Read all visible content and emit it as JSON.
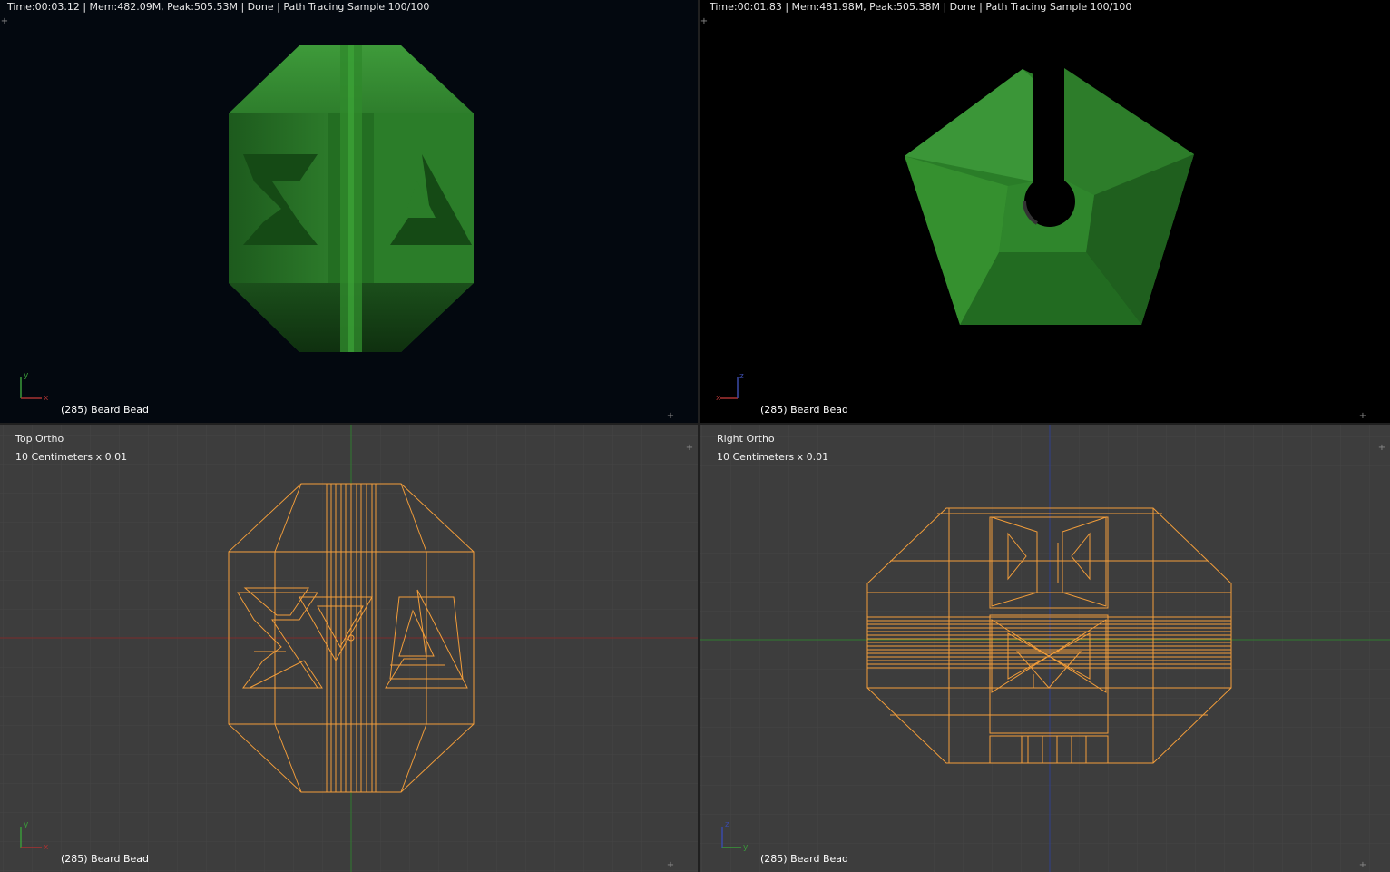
{
  "viewports": {
    "top_left": {
      "render_info": "Time:00:03.12 | Mem:482.09M, Peak:505.53M | Done | Path Tracing Sample 100/100",
      "object_label": "(285) Beard Bead",
      "axis_labels": {
        "a": "y",
        "b": "x"
      }
    },
    "top_right": {
      "render_info": "Time:00:01.83 | Mem:481.98M, Peak:505.38M | Done | Path Tracing Sample 100/100",
      "object_label": "(285) Beard Bead",
      "axis_labels": {
        "a": "z",
        "b": "x"
      }
    },
    "bottom_left": {
      "view_name": "Top Ortho",
      "scale": "10 Centimeters x 0.01",
      "object_label": "(285) Beard Bead",
      "axis_labels": {
        "a": "y",
        "b": "x"
      }
    },
    "bottom_right": {
      "view_name": "Right Ortho",
      "scale": "10 Centimeters x 0.01",
      "object_label": "(285) Beard Bead",
      "axis_labels": {
        "a": "z",
        "b": "y"
      }
    }
  },
  "colors": {
    "render_bg_left": "#03080f",
    "render_bg_right": "#000000",
    "viewport_bg": "#3d3d3d",
    "grid_line": "#444444",
    "wireframe": "#f29d3a",
    "x_axis": "#a83232",
    "y_axis": "#3a9a3a",
    "z_axis": "#3a4aa8",
    "bead_green": "#2f8a2f"
  }
}
